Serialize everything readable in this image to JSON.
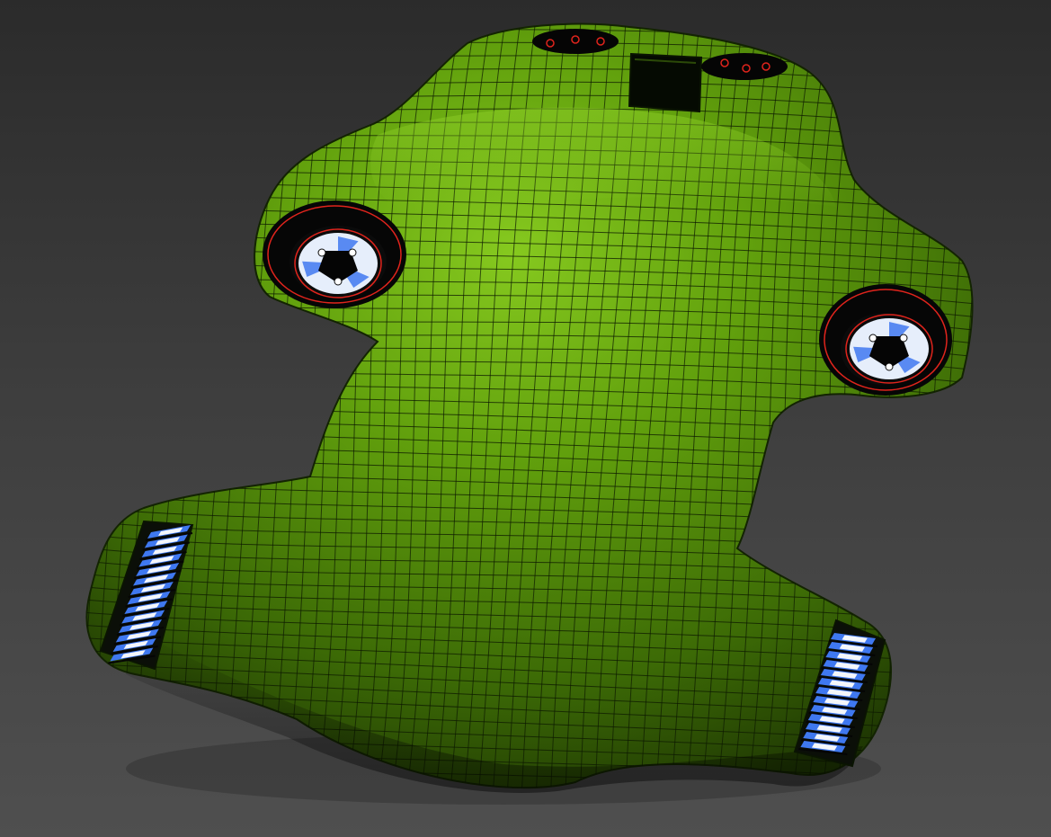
{
  "viewport": {
    "background_top": "#2b2b2b",
    "background_bottom": "#4f4f4f"
  },
  "model": {
    "body_color": "#5f9a0c",
    "body_highlight": "#7fc21a",
    "body_shadow": "#1d3202",
    "wire_color": "#0d1a02",
    "port_rim_color": "#e0241c",
    "port_inner_color": "#e6eefb",
    "vent_blue": "#3f78f0",
    "vent_white": "#f4f6fa",
    "ports": [
      {
        "name": "port-left-upper",
        "icon": "thruster-port-icon"
      },
      {
        "name": "port-right-upper",
        "icon": "thruster-port-icon"
      },
      {
        "name": "port-top-left",
        "icon": "sensor-port-icon"
      },
      {
        "name": "port-top-right",
        "icon": "sensor-port-icon"
      }
    ],
    "vents": [
      {
        "name": "vent-left-lower"
      },
      {
        "name": "vent-right-lower"
      }
    ]
  }
}
